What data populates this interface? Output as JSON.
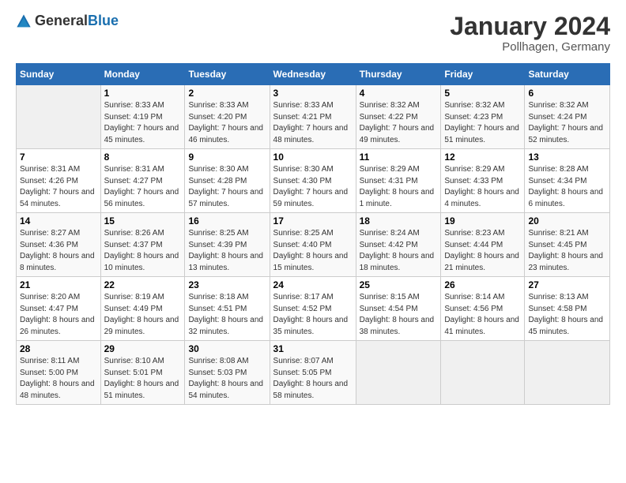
{
  "logo": {
    "general": "General",
    "blue": "Blue"
  },
  "title": "January 2024",
  "location": "Pollhagen, Germany",
  "days_header": [
    "Sunday",
    "Monday",
    "Tuesday",
    "Wednesday",
    "Thursday",
    "Friday",
    "Saturday"
  ],
  "weeks": [
    [
      {
        "num": "",
        "sunrise": "",
        "sunset": "",
        "daylight": ""
      },
      {
        "num": "1",
        "sunrise": "Sunrise: 8:33 AM",
        "sunset": "Sunset: 4:19 PM",
        "daylight": "Daylight: 7 hours and 45 minutes."
      },
      {
        "num": "2",
        "sunrise": "Sunrise: 8:33 AM",
        "sunset": "Sunset: 4:20 PM",
        "daylight": "Daylight: 7 hours and 46 minutes."
      },
      {
        "num": "3",
        "sunrise": "Sunrise: 8:33 AM",
        "sunset": "Sunset: 4:21 PM",
        "daylight": "Daylight: 7 hours and 48 minutes."
      },
      {
        "num": "4",
        "sunrise": "Sunrise: 8:32 AM",
        "sunset": "Sunset: 4:22 PM",
        "daylight": "Daylight: 7 hours and 49 minutes."
      },
      {
        "num": "5",
        "sunrise": "Sunrise: 8:32 AM",
        "sunset": "Sunset: 4:23 PM",
        "daylight": "Daylight: 7 hours and 51 minutes."
      },
      {
        "num": "6",
        "sunrise": "Sunrise: 8:32 AM",
        "sunset": "Sunset: 4:24 PM",
        "daylight": "Daylight: 7 hours and 52 minutes."
      }
    ],
    [
      {
        "num": "7",
        "sunrise": "Sunrise: 8:31 AM",
        "sunset": "Sunset: 4:26 PM",
        "daylight": "Daylight: 7 hours and 54 minutes."
      },
      {
        "num": "8",
        "sunrise": "Sunrise: 8:31 AM",
        "sunset": "Sunset: 4:27 PM",
        "daylight": "Daylight: 7 hours and 56 minutes."
      },
      {
        "num": "9",
        "sunrise": "Sunrise: 8:30 AM",
        "sunset": "Sunset: 4:28 PM",
        "daylight": "Daylight: 7 hours and 57 minutes."
      },
      {
        "num": "10",
        "sunrise": "Sunrise: 8:30 AM",
        "sunset": "Sunset: 4:30 PM",
        "daylight": "Daylight: 7 hours and 59 minutes."
      },
      {
        "num": "11",
        "sunrise": "Sunrise: 8:29 AM",
        "sunset": "Sunset: 4:31 PM",
        "daylight": "Daylight: 8 hours and 1 minute."
      },
      {
        "num": "12",
        "sunrise": "Sunrise: 8:29 AM",
        "sunset": "Sunset: 4:33 PM",
        "daylight": "Daylight: 8 hours and 4 minutes."
      },
      {
        "num": "13",
        "sunrise": "Sunrise: 8:28 AM",
        "sunset": "Sunset: 4:34 PM",
        "daylight": "Daylight: 8 hours and 6 minutes."
      }
    ],
    [
      {
        "num": "14",
        "sunrise": "Sunrise: 8:27 AM",
        "sunset": "Sunset: 4:36 PM",
        "daylight": "Daylight: 8 hours and 8 minutes."
      },
      {
        "num": "15",
        "sunrise": "Sunrise: 8:26 AM",
        "sunset": "Sunset: 4:37 PM",
        "daylight": "Daylight: 8 hours and 10 minutes."
      },
      {
        "num": "16",
        "sunrise": "Sunrise: 8:25 AM",
        "sunset": "Sunset: 4:39 PM",
        "daylight": "Daylight: 8 hours and 13 minutes."
      },
      {
        "num": "17",
        "sunrise": "Sunrise: 8:25 AM",
        "sunset": "Sunset: 4:40 PM",
        "daylight": "Daylight: 8 hours and 15 minutes."
      },
      {
        "num": "18",
        "sunrise": "Sunrise: 8:24 AM",
        "sunset": "Sunset: 4:42 PM",
        "daylight": "Daylight: 8 hours and 18 minutes."
      },
      {
        "num": "19",
        "sunrise": "Sunrise: 8:23 AM",
        "sunset": "Sunset: 4:44 PM",
        "daylight": "Daylight: 8 hours and 21 minutes."
      },
      {
        "num": "20",
        "sunrise": "Sunrise: 8:21 AM",
        "sunset": "Sunset: 4:45 PM",
        "daylight": "Daylight: 8 hours and 23 minutes."
      }
    ],
    [
      {
        "num": "21",
        "sunrise": "Sunrise: 8:20 AM",
        "sunset": "Sunset: 4:47 PM",
        "daylight": "Daylight: 8 hours and 26 minutes."
      },
      {
        "num": "22",
        "sunrise": "Sunrise: 8:19 AM",
        "sunset": "Sunset: 4:49 PM",
        "daylight": "Daylight: 8 hours and 29 minutes."
      },
      {
        "num": "23",
        "sunrise": "Sunrise: 8:18 AM",
        "sunset": "Sunset: 4:51 PM",
        "daylight": "Daylight: 8 hours and 32 minutes."
      },
      {
        "num": "24",
        "sunrise": "Sunrise: 8:17 AM",
        "sunset": "Sunset: 4:52 PM",
        "daylight": "Daylight: 8 hours and 35 minutes."
      },
      {
        "num": "25",
        "sunrise": "Sunrise: 8:15 AM",
        "sunset": "Sunset: 4:54 PM",
        "daylight": "Daylight: 8 hours and 38 minutes."
      },
      {
        "num": "26",
        "sunrise": "Sunrise: 8:14 AM",
        "sunset": "Sunset: 4:56 PM",
        "daylight": "Daylight: 8 hours and 41 minutes."
      },
      {
        "num": "27",
        "sunrise": "Sunrise: 8:13 AM",
        "sunset": "Sunset: 4:58 PM",
        "daylight": "Daylight: 8 hours and 45 minutes."
      }
    ],
    [
      {
        "num": "28",
        "sunrise": "Sunrise: 8:11 AM",
        "sunset": "Sunset: 5:00 PM",
        "daylight": "Daylight: 8 hours and 48 minutes."
      },
      {
        "num": "29",
        "sunrise": "Sunrise: 8:10 AM",
        "sunset": "Sunset: 5:01 PM",
        "daylight": "Daylight: 8 hours and 51 minutes."
      },
      {
        "num": "30",
        "sunrise": "Sunrise: 8:08 AM",
        "sunset": "Sunset: 5:03 PM",
        "daylight": "Daylight: 8 hours and 54 minutes."
      },
      {
        "num": "31",
        "sunrise": "Sunrise: 8:07 AM",
        "sunset": "Sunset: 5:05 PM",
        "daylight": "Daylight: 8 hours and 58 minutes."
      },
      {
        "num": "",
        "sunrise": "",
        "sunset": "",
        "daylight": ""
      },
      {
        "num": "",
        "sunrise": "",
        "sunset": "",
        "daylight": ""
      },
      {
        "num": "",
        "sunrise": "",
        "sunset": "",
        "daylight": ""
      }
    ]
  ]
}
